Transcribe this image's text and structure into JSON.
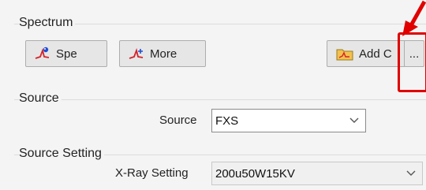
{
  "spectrum": {
    "title": "Spectrum",
    "buttons": {
      "spe_label": "Spe",
      "more_label": "More",
      "add_label": "Add C",
      "ellipsis_label": "..."
    }
  },
  "source": {
    "title": "Source",
    "field_label": "Source",
    "value": "FXS"
  },
  "source_setting": {
    "title": "Source Setting",
    "field_label": "X-Ray Setting",
    "value": "200u50W15KV"
  },
  "colors": {
    "highlight": "#e00000",
    "icon_red": "#d4232a",
    "icon_blue": "#1f4fd1"
  },
  "icons": [
    "spectrum-icon",
    "more-icon",
    "folder-chart-icon",
    "chevron-down-icon",
    "red-arrow-icon"
  ]
}
